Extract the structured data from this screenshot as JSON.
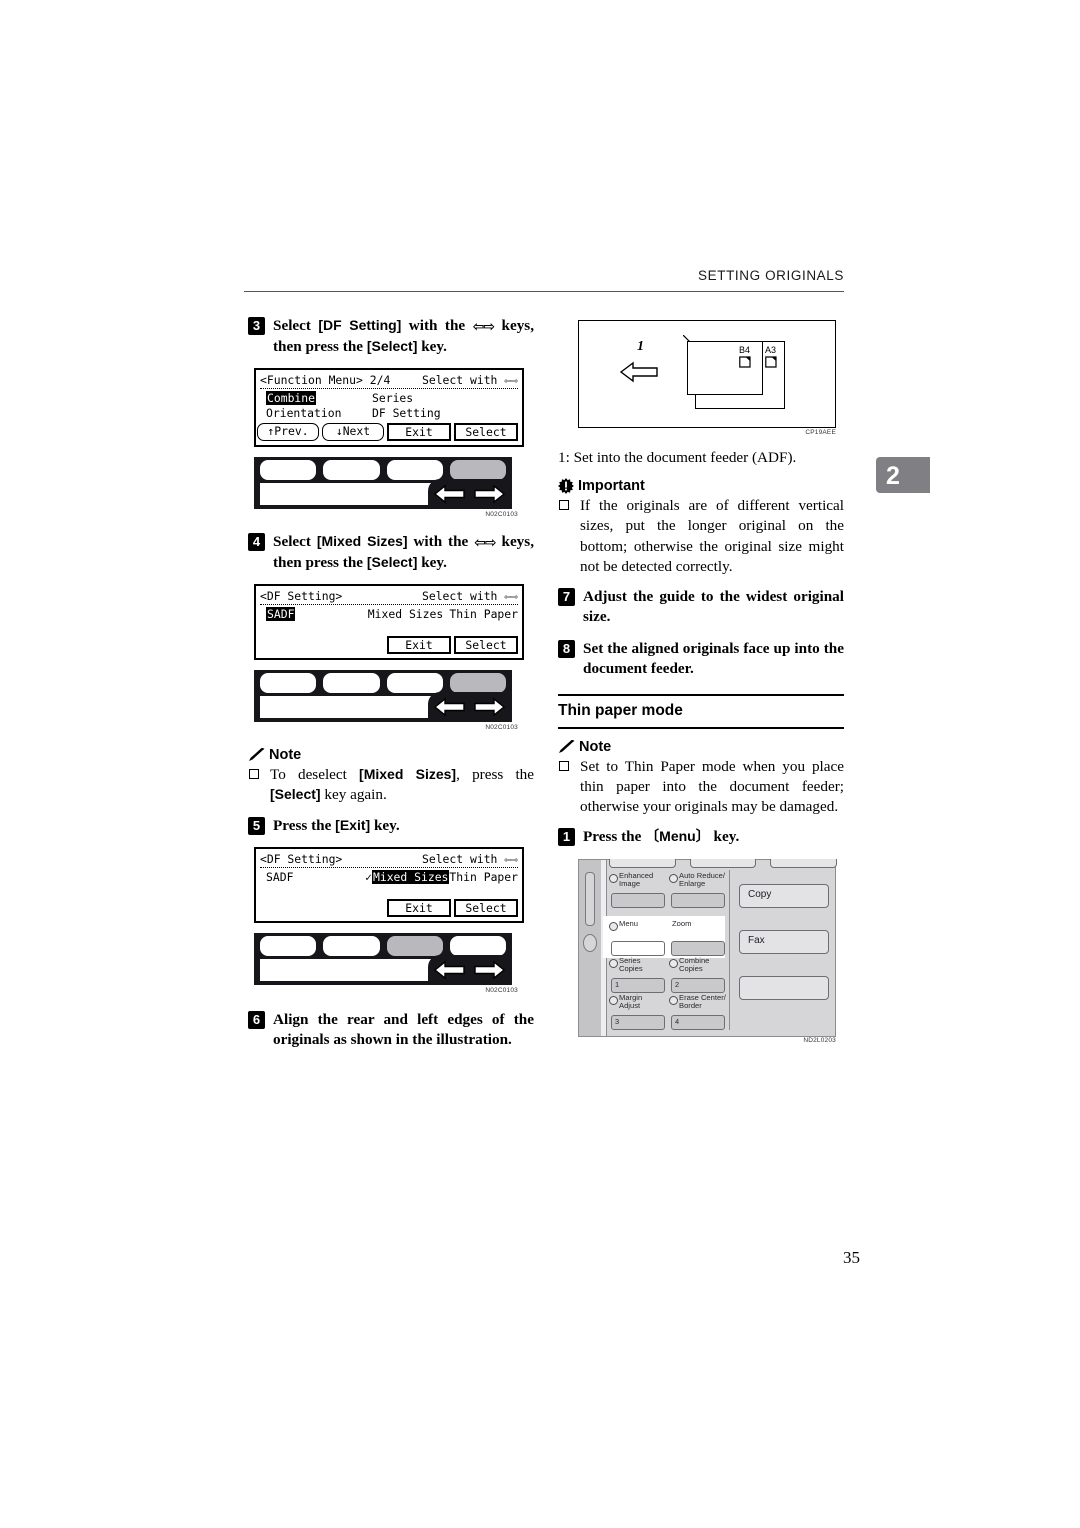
{
  "header": {
    "running_head": "SETTING ORIGINALS"
  },
  "chapter_tab": {
    "number": "2"
  },
  "page_number": "35",
  "left_column": {
    "step3": {
      "num": "3",
      "text_a": "Select ",
      "key_a": "[DF Setting]",
      "text_b": " with the ",
      "arrows": "⇦⇨",
      "text_c": " keys, then press the ",
      "key_b": "[Select]",
      "text_d": " key."
    },
    "lcd1": {
      "title": "<Function Menu> 2/4",
      "hint": "Select with ⇦⇨",
      "items": [
        "Combine",
        "Series",
        "Orientation",
        "DF Setting"
      ],
      "selected": "Combine",
      "buttons": [
        "↑Prev.",
        "↓Next",
        "Exit",
        "Select"
      ]
    },
    "panel1": {
      "highlight_index": 3,
      "code": "N02C0103"
    },
    "step4": {
      "num": "4",
      "text_a": "Select ",
      "key_a": "[Mixed Sizes]",
      "text_b": " with the ",
      "arrows": "⇦⇨",
      "text_c": " keys, then press the ",
      "key_b": "[Select]",
      "text_d": " key."
    },
    "lcd2": {
      "title": "<DF Setting>",
      "hint": "Select with ⇦⇨",
      "items": [
        "SADF",
        "Mixed Sizes",
        "Thin Paper"
      ],
      "selected": "SADF",
      "checked": "",
      "buttons": [
        "Exit",
        "Select"
      ]
    },
    "panel2": {
      "highlight_index": 3,
      "code": "N02C0103"
    },
    "note1": {
      "heading": "Note",
      "text_a": "To deselect ",
      "key_a": "[Mixed Sizes]",
      "text_b": ", press the ",
      "key_b": "[Select]",
      "text_c": " key again."
    },
    "step5": {
      "num": "5",
      "text_a": "Press the ",
      "key_a": "[Exit]",
      "text_b": " key."
    },
    "lcd3": {
      "title": "<DF Setting>",
      "hint": "Select with ⇦⇨",
      "items": [
        "SADF",
        "Mixed Sizes",
        "Thin Paper"
      ],
      "selected": "Mixed Sizes",
      "checked": "✓",
      "buttons": [
        "Exit",
        "Select"
      ]
    },
    "panel3": {
      "highlight_index": 2,
      "code": "N02C0103"
    },
    "step6": {
      "num": "6",
      "text": "Align the rear and left edges of the originals as shown in the illustration."
    }
  },
  "right_column": {
    "figure_orig": {
      "index_label": "1",
      "size_label_1": "B4",
      "size_label_2": "A3",
      "code": "CP19AEE"
    },
    "caption": "1: Set into the document feeder (ADF).",
    "important": {
      "heading": "Important",
      "text": "If the originals are of different vertical sizes, put the longer original on the bottom; otherwise the original size might not be detected correctly."
    },
    "step7": {
      "num": "7",
      "text": "Adjust the guide to the widest original size."
    },
    "step8": {
      "num": "8",
      "text": "Set the aligned originals face up into the document feeder."
    },
    "section": {
      "title": "Thin paper mode"
    },
    "note2": {
      "heading": "Note",
      "text": "Set to Thin Paper mode when you place thin paper into the document feeder; otherwise your originals may be damaged."
    },
    "step1": {
      "num": "1",
      "text_a": "Press the ",
      "key_a": "〔Menu〕",
      "text_b": " key."
    },
    "control_panel": {
      "cells": [
        {
          "label": "Enhanced\nImage",
          "btn": ""
        },
        {
          "label": "Auto Reduce/\nEnlarge",
          "btn": ""
        },
        {
          "label": "Menu",
          "btn": ""
        },
        {
          "label": "Zoom",
          "btn": ""
        },
        {
          "label": "Series\nCopies",
          "btn": "1"
        },
        {
          "label": "Combine\nCopies",
          "btn": "2"
        },
        {
          "label": "Margin\nAdjust",
          "btn": "3"
        },
        {
          "label": "Erase Center/\nBorder",
          "btn": "4"
        }
      ],
      "big_buttons": [
        "Copy",
        "Fax",
        ""
      ],
      "code": "ND2L0203"
    }
  }
}
